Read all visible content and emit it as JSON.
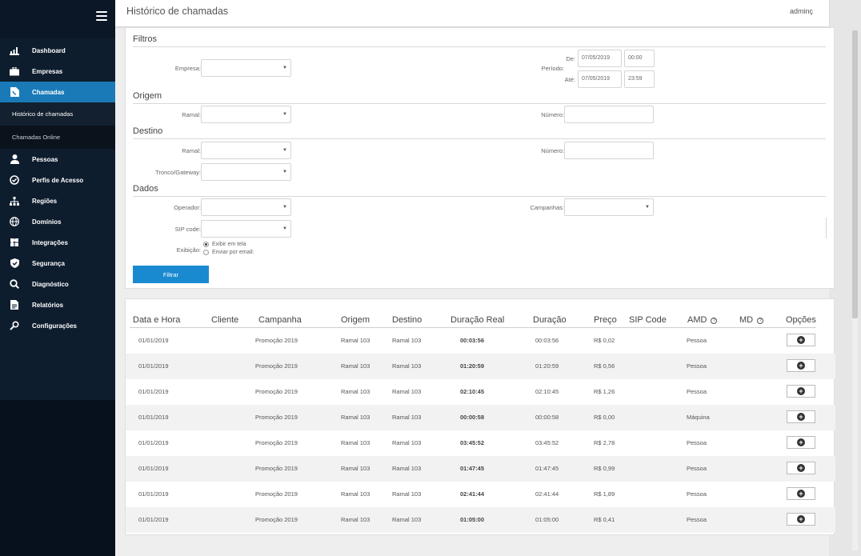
{
  "header": {
    "title": "Histórico de chamadas",
    "user": "adminç"
  },
  "sidebar": {
    "items": [
      {
        "label": "Dashboard",
        "icon": "chart-icon"
      },
      {
        "label": "Empresas",
        "icon": "briefcase-icon"
      },
      {
        "label": "Chamadas",
        "icon": "document-phone-icon",
        "active": true
      },
      {
        "label": "Pessoas",
        "icon": "person-icon"
      },
      {
        "label": "Perfis de Acesso",
        "icon": "check-circle-icon"
      },
      {
        "label": "Regiões",
        "icon": "hierarchy-icon"
      },
      {
        "label": "Domínios",
        "icon": "globe-icon"
      },
      {
        "label": "Integrações",
        "icon": "puzzle-icon"
      },
      {
        "label": "Segurança",
        "icon": "shield-icon"
      },
      {
        "label": "Diagnóstico",
        "icon": "search-icon"
      },
      {
        "label": "Relatórios",
        "icon": "report-icon"
      },
      {
        "label": "Configurações",
        "icon": "wrench-icon"
      }
    ],
    "sub_items": [
      {
        "label": "Histórico de chamadas"
      },
      {
        "label": "Chamadas Online"
      }
    ]
  },
  "filters": {
    "title": "Filtros",
    "empresa_label": "Empresa:",
    "periodo_label": "Período:",
    "de_label": "De:",
    "ate_label": "Até:",
    "de_date": "07/05/2019",
    "de_time": "00:00",
    "ate_date": "07/05/2019",
    "ate_time": "23:59",
    "origem_title": "Origem",
    "destino_title": "Destino",
    "dados_title": "Dados",
    "ramal_label": "Ramal:",
    "numero_label": "Número:",
    "tronco_label": "Tronco/Gateway:",
    "operador_label": "Operador:",
    "campanhas_label": "Campanhas:",
    "sip_label": "SIP code:",
    "exibicao_label": "Exibição:",
    "exibir_tela": "Exibir em tela",
    "enviar_email": "Enviar por email:",
    "filtrar_button": "Filtrar"
  },
  "table": {
    "headers": [
      "Data e Hora",
      "Cliente",
      "Campanha",
      "Origem",
      "Destino",
      "Duração Real",
      "Duração",
      "Preço",
      "SIP Code",
      "AMD",
      "MD",
      "Opções"
    ],
    "rows": [
      [
        "01/01/2019",
        "",
        "Promoção 2019",
        "Ramal 103",
        "Ramal 103",
        "00:03:56",
        "00:03:56",
        "R$ 0,02",
        "",
        "Pessoa"
      ],
      [
        "01/01/2019",
        "",
        "Promoção 2019",
        "Ramal 103",
        "Ramal 103",
        "01:20:59",
        "01:20:59",
        "R$ 0,56",
        "",
        "Pessoa"
      ],
      [
        "01/01/2019",
        "",
        "Promoção 2019",
        "Ramal 103",
        "Ramal 103",
        "02:10:45",
        "02:10:45",
        "R$ 1,26",
        "",
        "Pessoa"
      ],
      [
        "01/01/2019",
        "",
        "Promoção 2019",
        "Ramal 103",
        "Ramal 103",
        "00:00:58",
        "00:00:58",
        "R$ 0,00",
        "",
        "Máquina"
      ],
      [
        "01/01/2019",
        "",
        "Promoção 2019",
        "Ramal 103",
        "Ramal 103",
        "03:45:52",
        "03:45:52",
        "R$ 2,78",
        "",
        "Pessoa"
      ],
      [
        "01/01/2019",
        "",
        "Promoção 2019",
        "Ramal 103",
        "Ramal 103",
        "01:47:45",
        "01:47:45",
        "R$ 0,99",
        "",
        "Pessoa"
      ],
      [
        "01/01/2019",
        "",
        "Promoção 2019",
        "Ramal 103",
        "Ramal 103",
        "02:41:44",
        "02:41:44",
        "R$ 1,89",
        "",
        "Pessoa"
      ],
      [
        "01/01/2019",
        "",
        "Promoção 2019",
        "Ramal 103",
        "Ramal 103",
        "01:05:00",
        "01:05:00",
        "R$ 0,41",
        "",
        "Pessoa"
      ]
    ]
  },
  "colors": {
    "sidebar": "#0e1d2e",
    "active": "#1a7ab8",
    "button": "#1a8ad0"
  }
}
